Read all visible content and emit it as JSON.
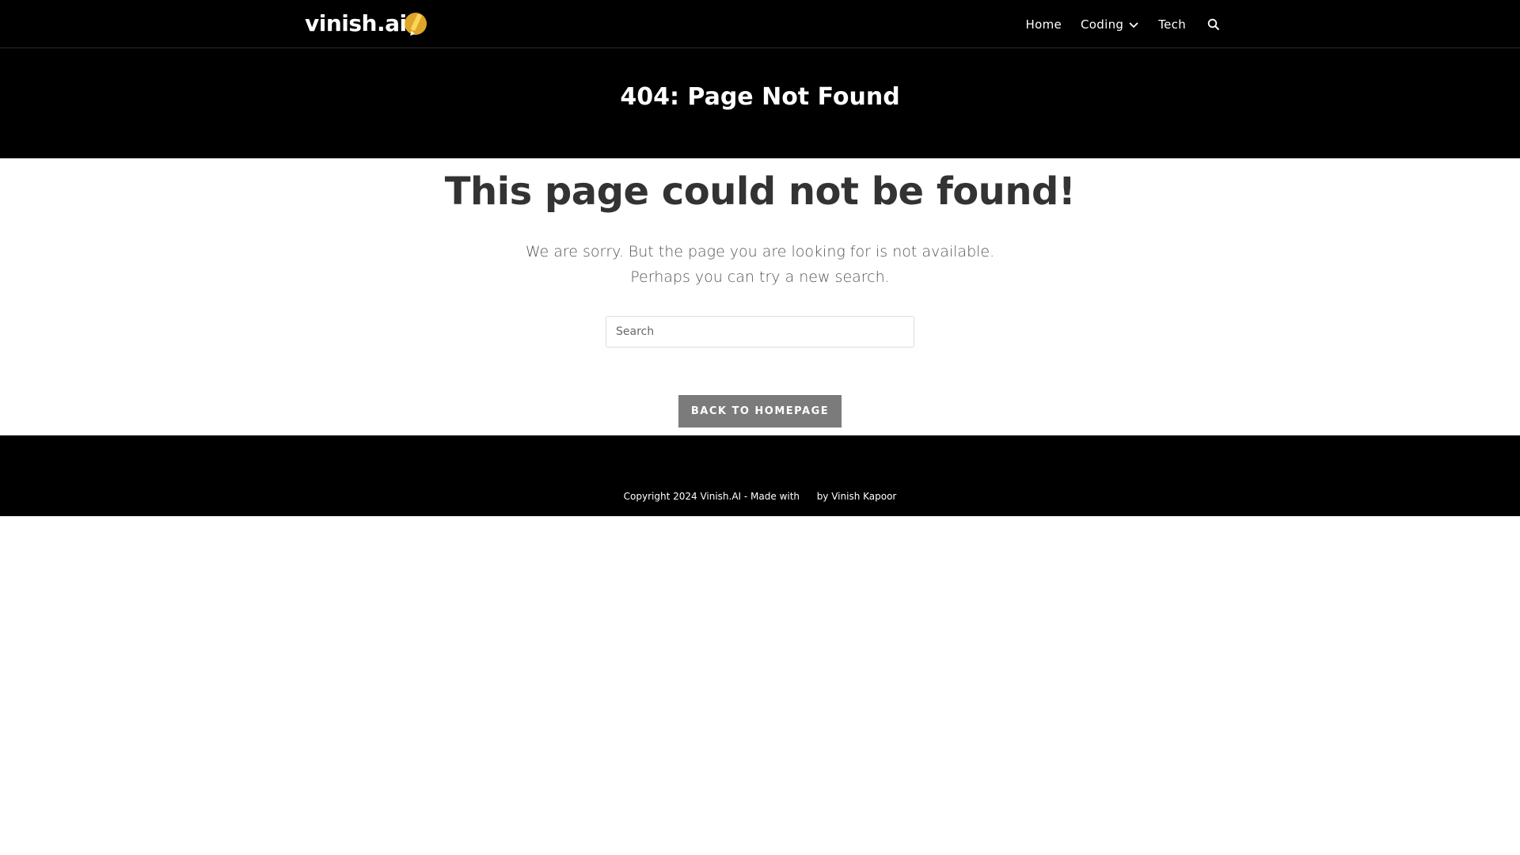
{
  "header": {
    "logo_text": "vinish.ai",
    "nav": {
      "home": "Home",
      "coding": "Coding",
      "tech": "Tech"
    }
  },
  "page_title": "404: Page Not Found",
  "main": {
    "heading": "This page could not be found!",
    "message_line1": "We are sorry. But the page you are looking for is not available.",
    "message_line2": "Perhaps you can try a new search.",
    "search_placeholder": "Search",
    "back_button": "BACK TO HOMEPAGE"
  },
  "footer": {
    "copyright_prefix": "Copyright 2024 Vinish.AI - Made with",
    "copyright_suffix": "by Vinish Kapoor"
  },
  "colors": {
    "header_bg": "#000000",
    "logo_accent": "#f5b82e",
    "heading_text": "#333333",
    "button_bg": "#7b7b7b"
  },
  "icons": {
    "logo_mark": "pencil-icon",
    "coding_dropdown": "chevron-down-icon",
    "search": "search-icon",
    "footer_heart": "heart-icon"
  }
}
